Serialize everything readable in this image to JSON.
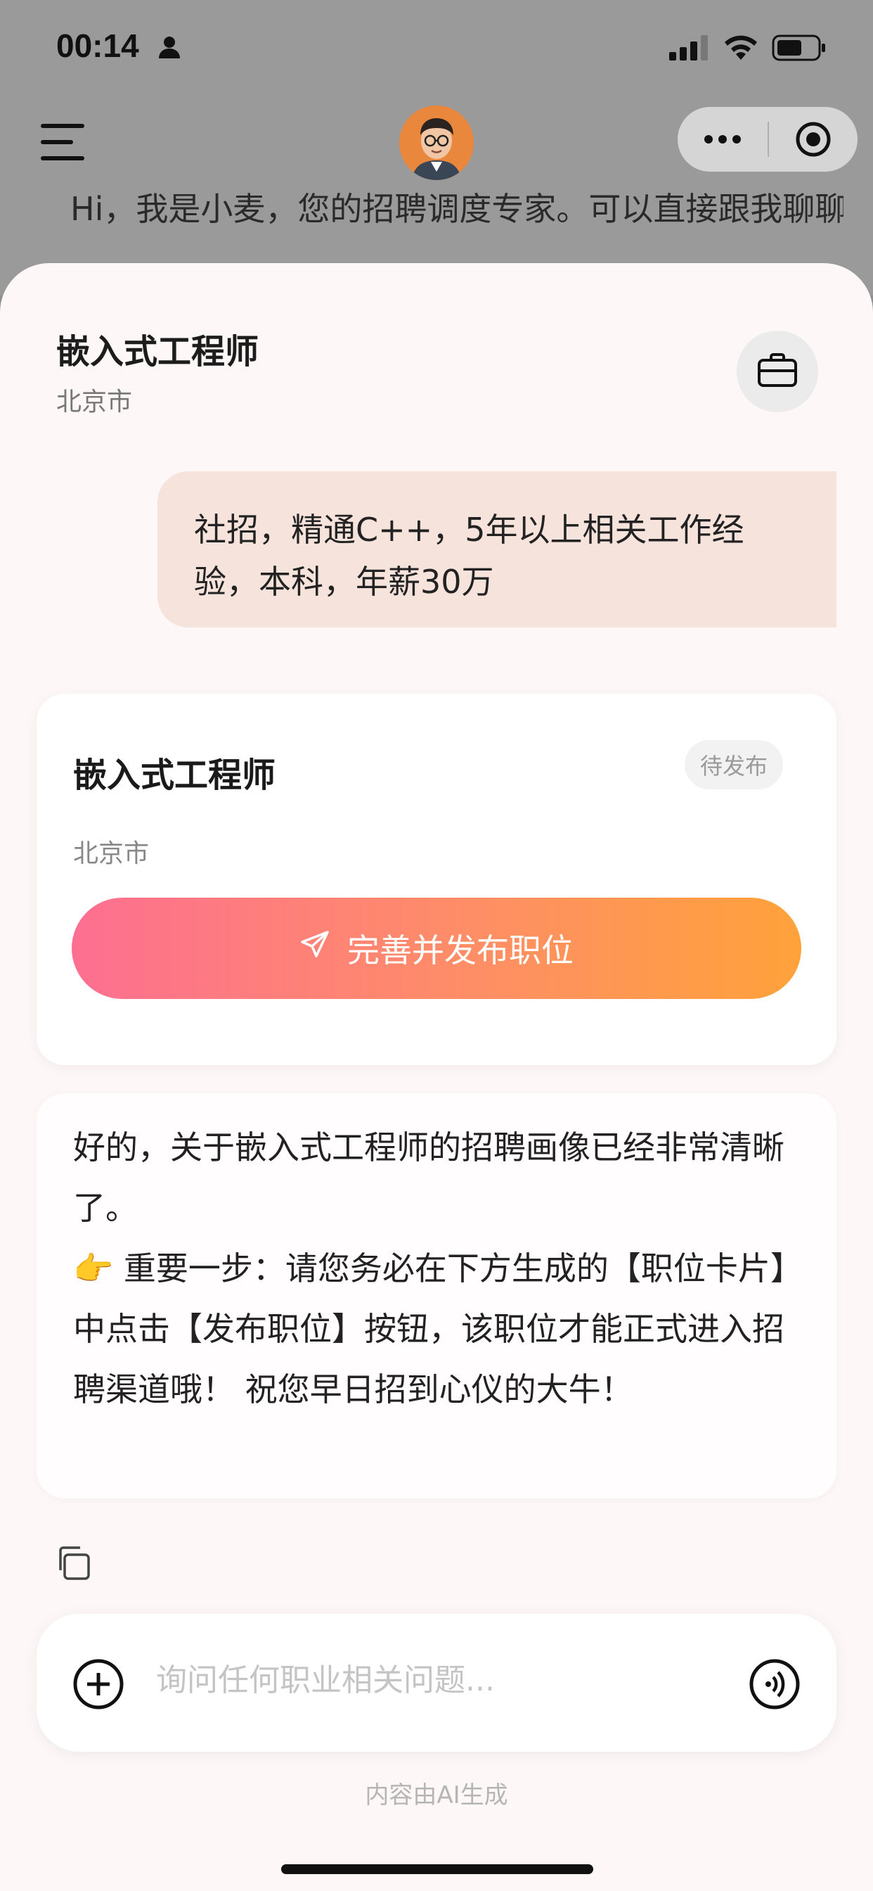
{
  "status_bar": {
    "time": "00:14",
    "icons": [
      "person-icon",
      "cellular-signal-icon",
      "wifi-icon",
      "battery-icon"
    ]
  },
  "header": {
    "behind_text": "Hi，我是小麦，您的招聘调度专家。可以直接跟我聊聊当下的招聘任务，或者直接告诉我你"
  },
  "sheet": {
    "job_title": "嵌入式工程师",
    "job_city": "北京市",
    "user_message": "社招，精通C++，5年以上相关工作经验，本科，年薪30万",
    "job_card": {
      "title": "嵌入式工程师",
      "status": "待发布",
      "city": "北京市",
      "publish_label": "完善并发布职位"
    },
    "ai_message": {
      "line1": "好的，关于嵌入式工程师的招聘画像已经非常清晰了。",
      "line2_emoji": "👉",
      "line2": " 重要一步：请您务必在下方生成的【职位卡片】中点击【发布职位】按钮，该职位才能正式进入招聘渠道哦！ 祝您早日招到心仪的大牛！"
    },
    "input": {
      "placeholder": "询问任何职业相关问题..."
    },
    "ai_note": "内容由AI生成"
  },
  "colors": {
    "gradient_start": "#fd6f91",
    "gradient_end": "#ffa23a",
    "user_bubble": "#f6e3dc",
    "sheet_bg": "#fdf7f7"
  }
}
